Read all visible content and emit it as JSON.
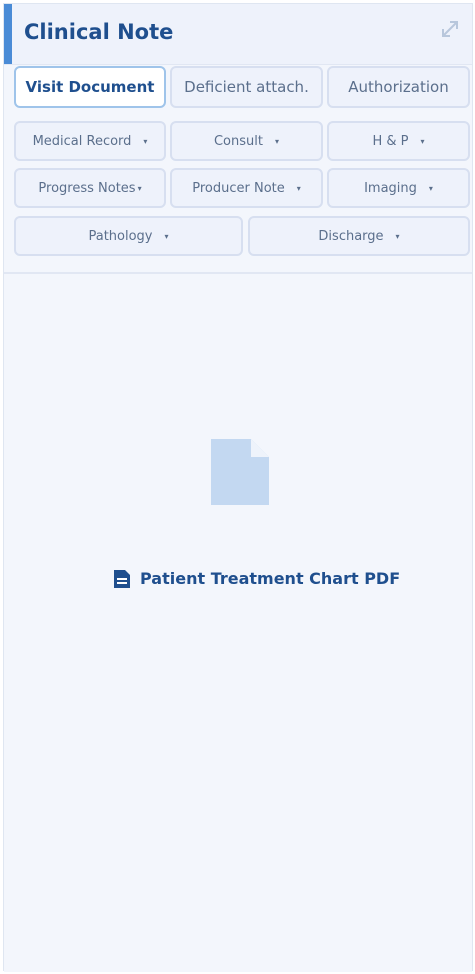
{
  "header": {
    "title": "Clinical Note"
  },
  "tabs": [
    {
      "label": "Visit Document"
    },
    {
      "label": "Deficient attach."
    },
    {
      "label": "Authorization"
    }
  ],
  "categories": {
    "row1": [
      {
        "label": "Medical Record"
      },
      {
        "label": "Consult"
      },
      {
        "label": "H & P"
      }
    ],
    "row2": [
      {
        "label": "Progress Notes"
      },
      {
        "label": "Producer Note"
      },
      {
        "label": "Imaging"
      }
    ],
    "row3": [
      {
        "label": "Pathology"
      },
      {
        "label": "Discharge"
      }
    ]
  },
  "caret_symbol": "▾",
  "viewer": {
    "link_label": "Patient Treatment Chart PDF"
  },
  "colors": {
    "accent": "#4a8bd6",
    "primary_text": "#1f4f8e",
    "doc_icon": "#c3d8f1"
  }
}
